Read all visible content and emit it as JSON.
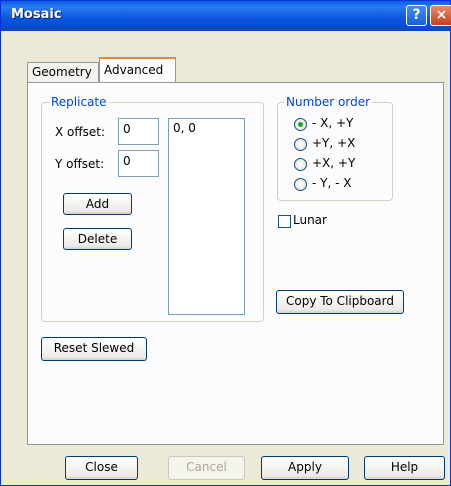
{
  "window": {
    "title": "Mosaic",
    "help_glyph": "?",
    "close_glyph": "×"
  },
  "tabs": [
    {
      "label": "Geometry",
      "selected": false
    },
    {
      "label": "Advanced",
      "selected": true
    }
  ],
  "replicate": {
    "group_label": "Replicate",
    "x_offset_label": "X offset:",
    "x_offset_value": "0",
    "y_offset_label": "Y offset:",
    "y_offset_value": "0",
    "list_items": [
      "0, 0"
    ],
    "add_label": "Add",
    "delete_label": "Delete"
  },
  "number_order": {
    "group_label": "Number order",
    "options": [
      {
        "label": "- X, +Y",
        "selected": true
      },
      {
        "label": "+Y, +X",
        "selected": false
      },
      {
        "label": "+X, +Y",
        "selected": false
      },
      {
        "label": "- Y, - X",
        "selected": false
      }
    ]
  },
  "lunar": {
    "label": "Lunar",
    "checked": false
  },
  "copy_button_label": "Copy To Clipboard",
  "reset_button_label": "Reset Slewed",
  "footer": {
    "close": "Close",
    "cancel": "Cancel",
    "apply": "Apply",
    "help": "Help"
  }
}
